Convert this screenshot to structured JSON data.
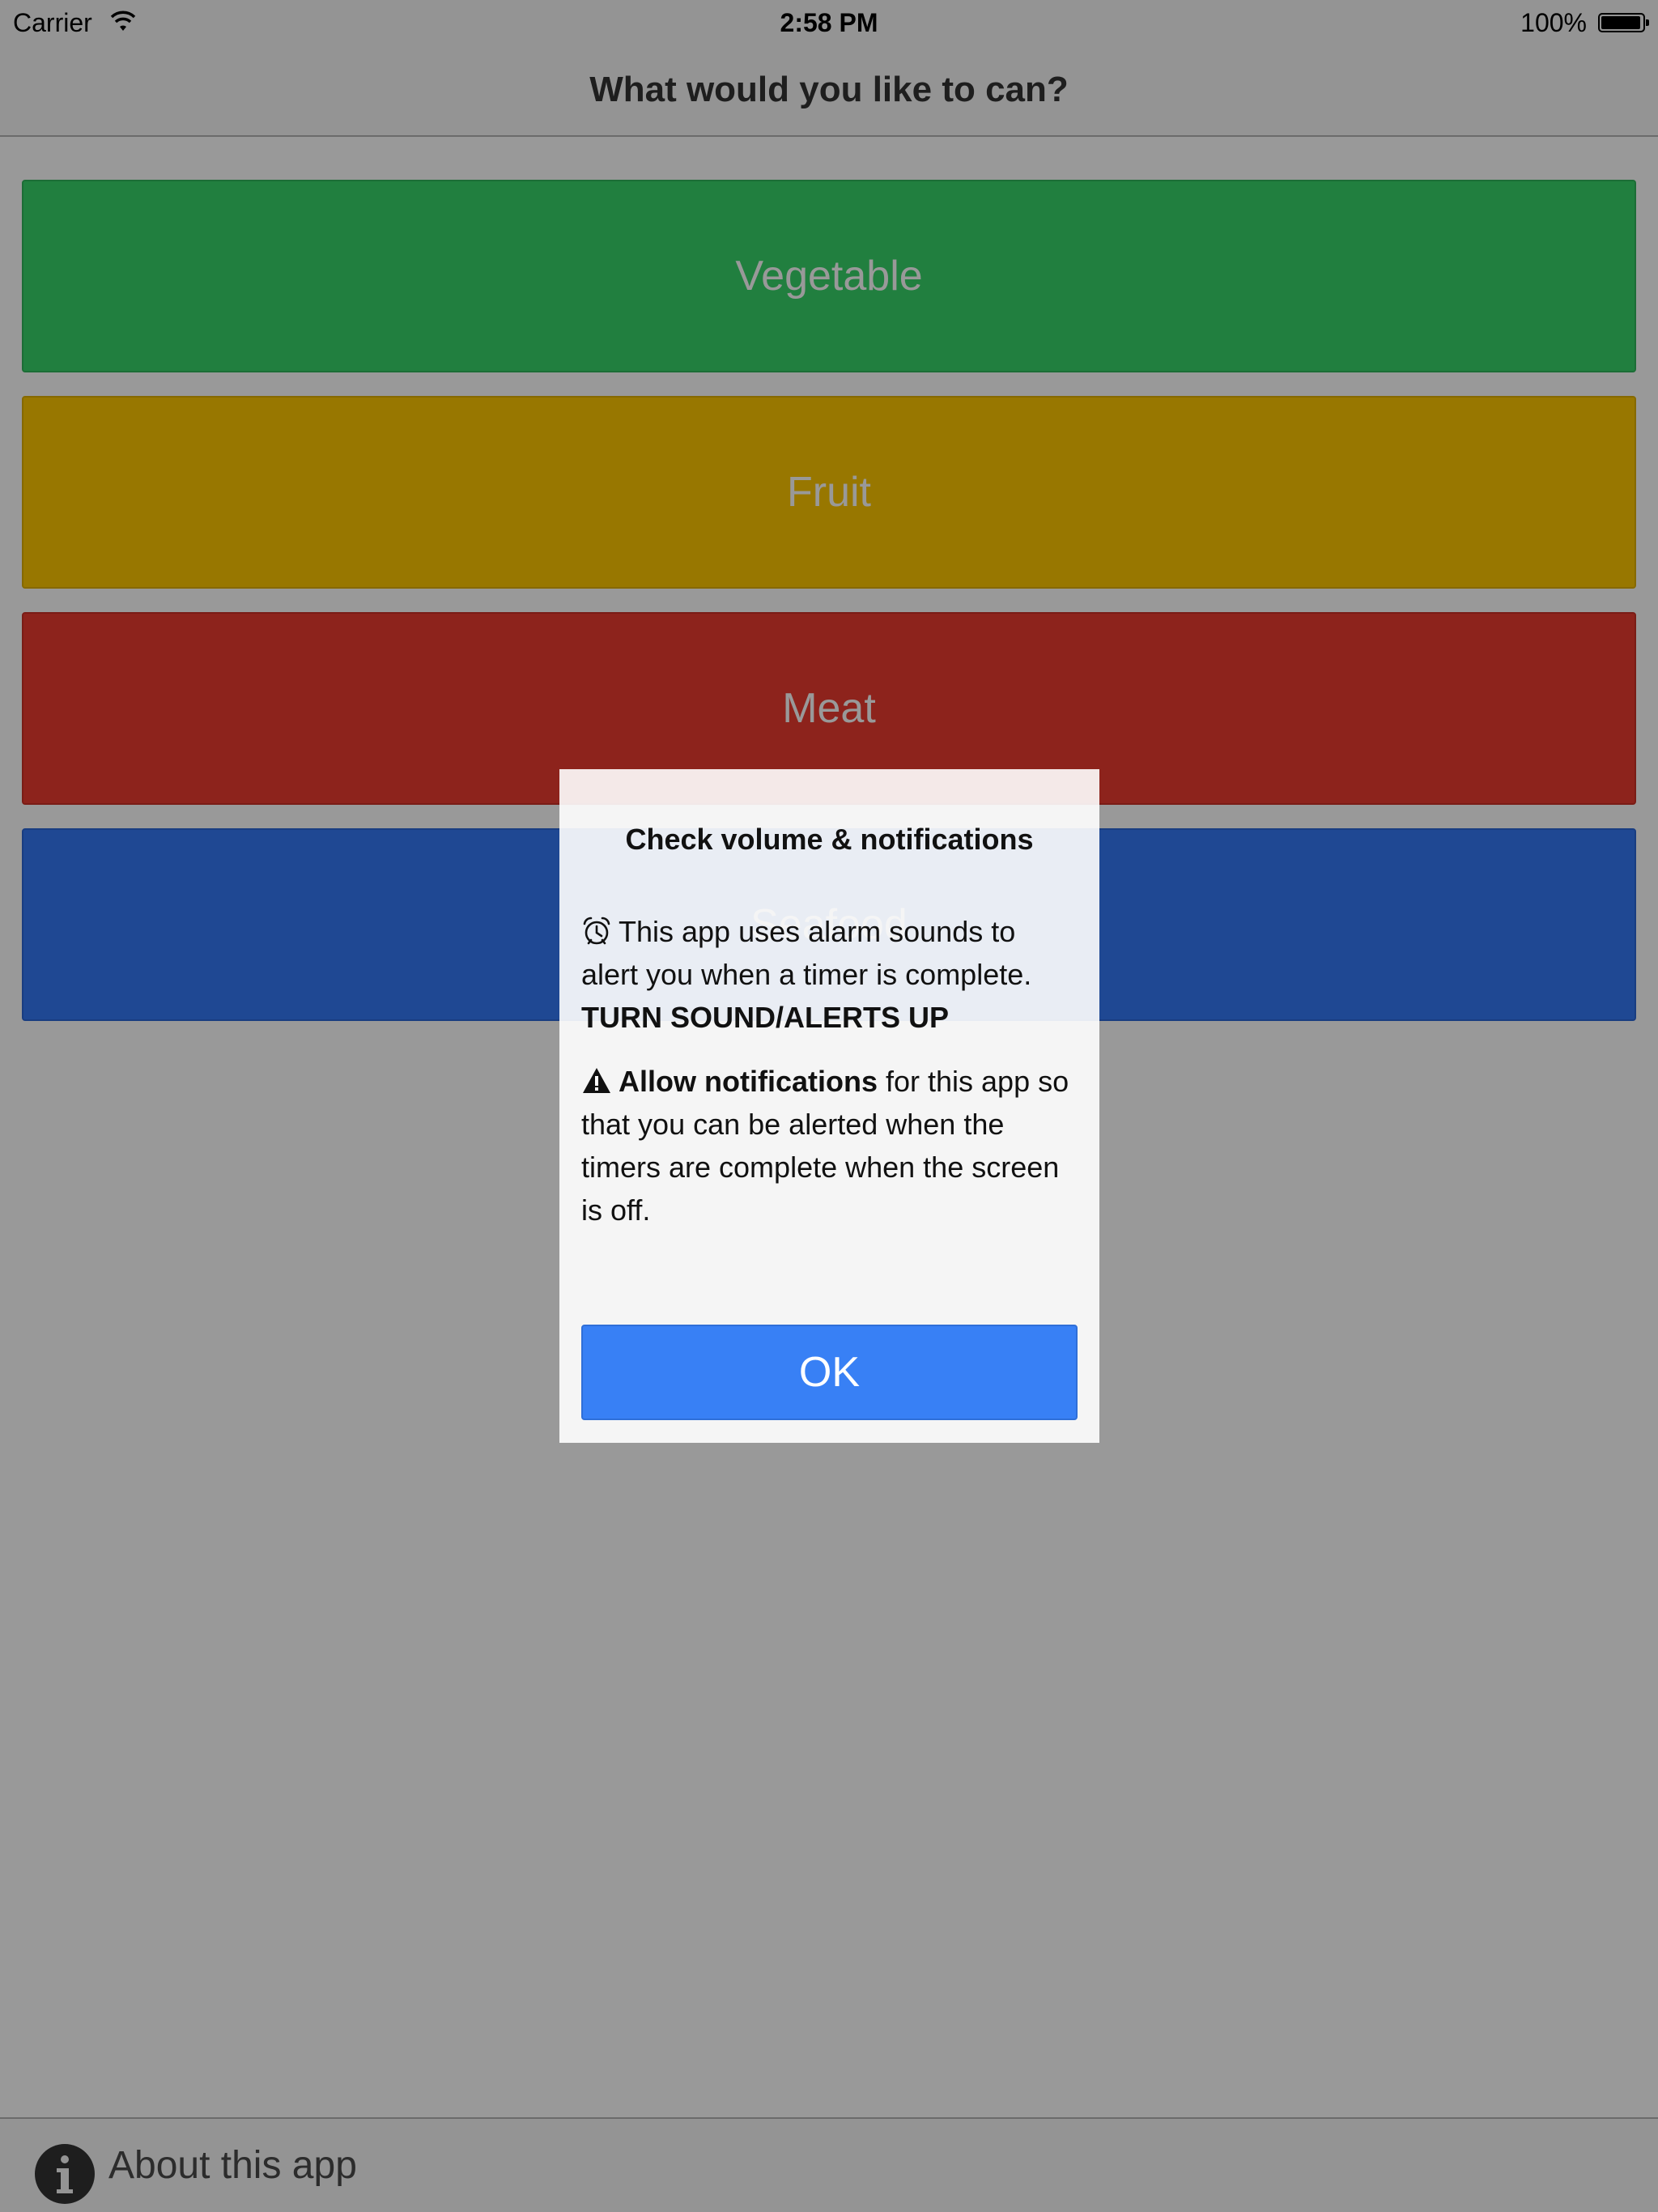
{
  "status_bar": {
    "carrier": "Carrier",
    "time": "2:58 PM",
    "battery": "100%"
  },
  "nav": {
    "title": "What would you like to can?"
  },
  "categories": [
    {
      "label": "Vegetable",
      "color": "#38d46a"
    },
    {
      "label": "Fruit",
      "color": "#fdc700"
    },
    {
      "label": "Meat",
      "color": "#ec3b2f"
    },
    {
      "label": "Seafood",
      "color": "#3479f6"
    }
  ],
  "footer": {
    "about_label": "About this app",
    "icon": "info-icon"
  },
  "modal": {
    "title": "Check volume & notifications",
    "para1_text": "This app uses alarm sounds to alert you when a timer is complete.",
    "para1_emphasis": "TURN SOUND/ALERTS UP",
    "para2_bold": "Allow notifications",
    "para2_text": " for this app so that you can be alerted when the timers are complete when the screen is off.",
    "ok_label": "OK",
    "alarm_icon": "alarm-clock-icon",
    "warning_icon": "warning-icon"
  }
}
